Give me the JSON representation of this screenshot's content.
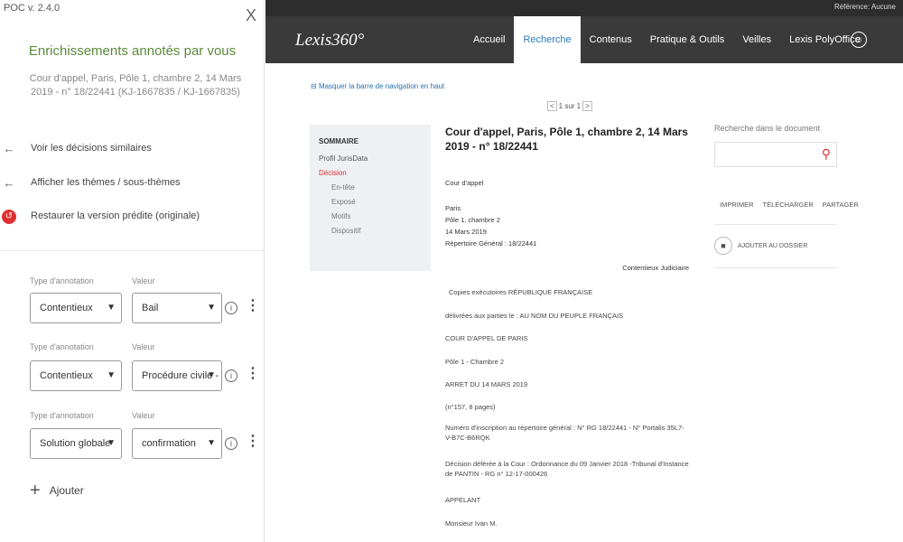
{
  "panel": {
    "version": "POC v. 2.4.0",
    "close_glyph": "X",
    "title": "Enrichissements annotés par vous",
    "doc_ref": "Cour d'appel, Paris, Pôle 1, chambre 2, 14 Mars 2019 - n° 18/22441 (KJ-1667835 / KJ-1667835)",
    "actions": [
      {
        "label": "Voir les décisions similaires",
        "icon": "arrow-left-icon"
      },
      {
        "label": "Afficher les thèmes / sous-thèmes",
        "icon": "arrow-left-icon"
      },
      {
        "label": "Restaurer la version prédite (originale)",
        "icon": "restore-icon"
      }
    ],
    "annotations": [
      {
        "type_label": "Type d'annotation",
        "value_label": "Valeur",
        "type": "Contentieux",
        "value": "Bail"
      },
      {
        "type_label": "Type d'annotation",
        "value_label": "Valeur",
        "type": "Contentieux",
        "value": "Procédure civile -"
      },
      {
        "type_label": "Type d'annotation",
        "value_label": "Valeur",
        "type": "Solution globale",
        "value": "confirmation"
      }
    ],
    "add_label": "Ajouter"
  },
  "lexis": {
    "reference": "Référence: Aucune",
    "logo": "Lexis360°",
    "nav": [
      "Accueil",
      "Recherche",
      "Contenus",
      "Pratique & Outils",
      "Veilles",
      "Lexis PolyOffice"
    ],
    "active_nav": "Recherche",
    "hide_nav": "Masquer la barre de navigation en haut",
    "pager": {
      "prev": "<",
      "text": "1 sur 1",
      "next": ">"
    },
    "toc": {
      "title": "SOMMAIRE",
      "items": [
        "Profil JurisData",
        "Décision",
        "En-tête",
        "Exposé",
        "Motifs",
        "Dispositif"
      ]
    },
    "doc": {
      "title": "Cour d'appel, Paris, Pôle 1, chambre 2, 14 Mars 2019 - n° 18/22441",
      "court": "Cour d'appel",
      "meta": [
        "Paris",
        "Pôle 1, chambre 2",
        "14 Mars 2019",
        "Répertoire Général : 18/22441"
      ],
      "category": "Contentieux Judiciaire",
      "paras": [
        "Copies exécutoires RÉPUBLIQUE FRANÇAISE",
        "délivrées aux parties le : AU NOM DU PEUPLE FRANÇAIS",
        "COUR D'APPEL DE PARIS",
        "Pôle 1 - Chambre 2",
        "ARRET DU 14 MARS 2019",
        "(n°157, 8 pages)",
        "Numéro d'inscription au répertoire général : N° RG 18/22441 - N° Portalis 35L7-V-B7C-B6RQK",
        "Décision déférée à la Cour : Ordonnance du 09 Janvier 2018 -Tribunal d'Instance de PANTIN - RG n° 12-17-000426",
        "APPELANT",
        "Monsieur Ivan M."
      ]
    },
    "search": {
      "label": "Recherche dans le document",
      "placeholder": ""
    },
    "tools": [
      "IMPRIMER",
      "TÉLÉCHARGER",
      "PARTAGER"
    ],
    "add_folder": "AJOUTER AU DOSSIER"
  }
}
